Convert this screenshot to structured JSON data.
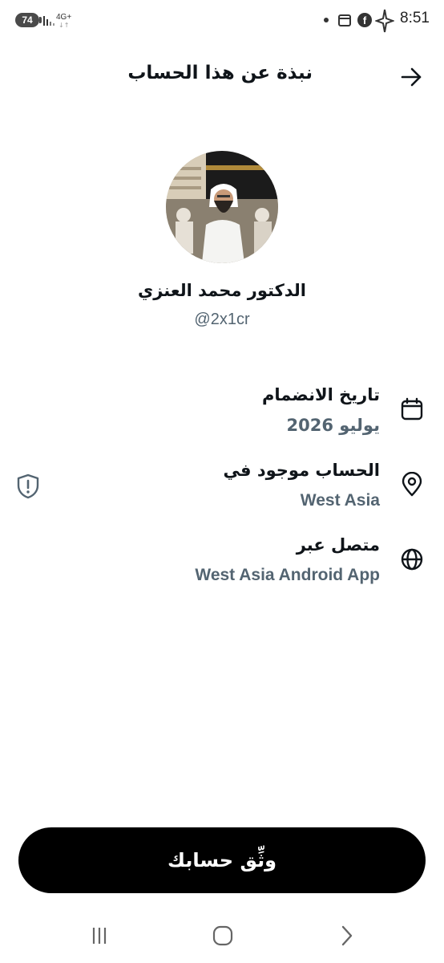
{
  "status_bar": {
    "battery": "74",
    "network": "4G+",
    "time": "8:51"
  },
  "header": {
    "title": "نبذة عن هذا الحساب",
    "back_icon": "arrow-right-icon"
  },
  "profile": {
    "display_name": "الدكتور محمد العنزي",
    "username": "@2x1cr"
  },
  "info_rows": [
    {
      "icon": "calendar-icon",
      "label": "تاريخ الانضمام",
      "value": "يوليو 2026"
    },
    {
      "icon": "location-pin-icon",
      "label": "الحساب موجود في",
      "value": "West Asia"
    },
    {
      "icon": "globe-icon",
      "label": "متصل عبر",
      "value": "West Asia Android App"
    }
  ],
  "verify_button": {
    "label": "وثِّق حسابك"
  },
  "colors": {
    "text_primary": "#0f1419",
    "text_secondary": "#536471",
    "button_bg": "#000000",
    "button_text": "#ffffff"
  }
}
